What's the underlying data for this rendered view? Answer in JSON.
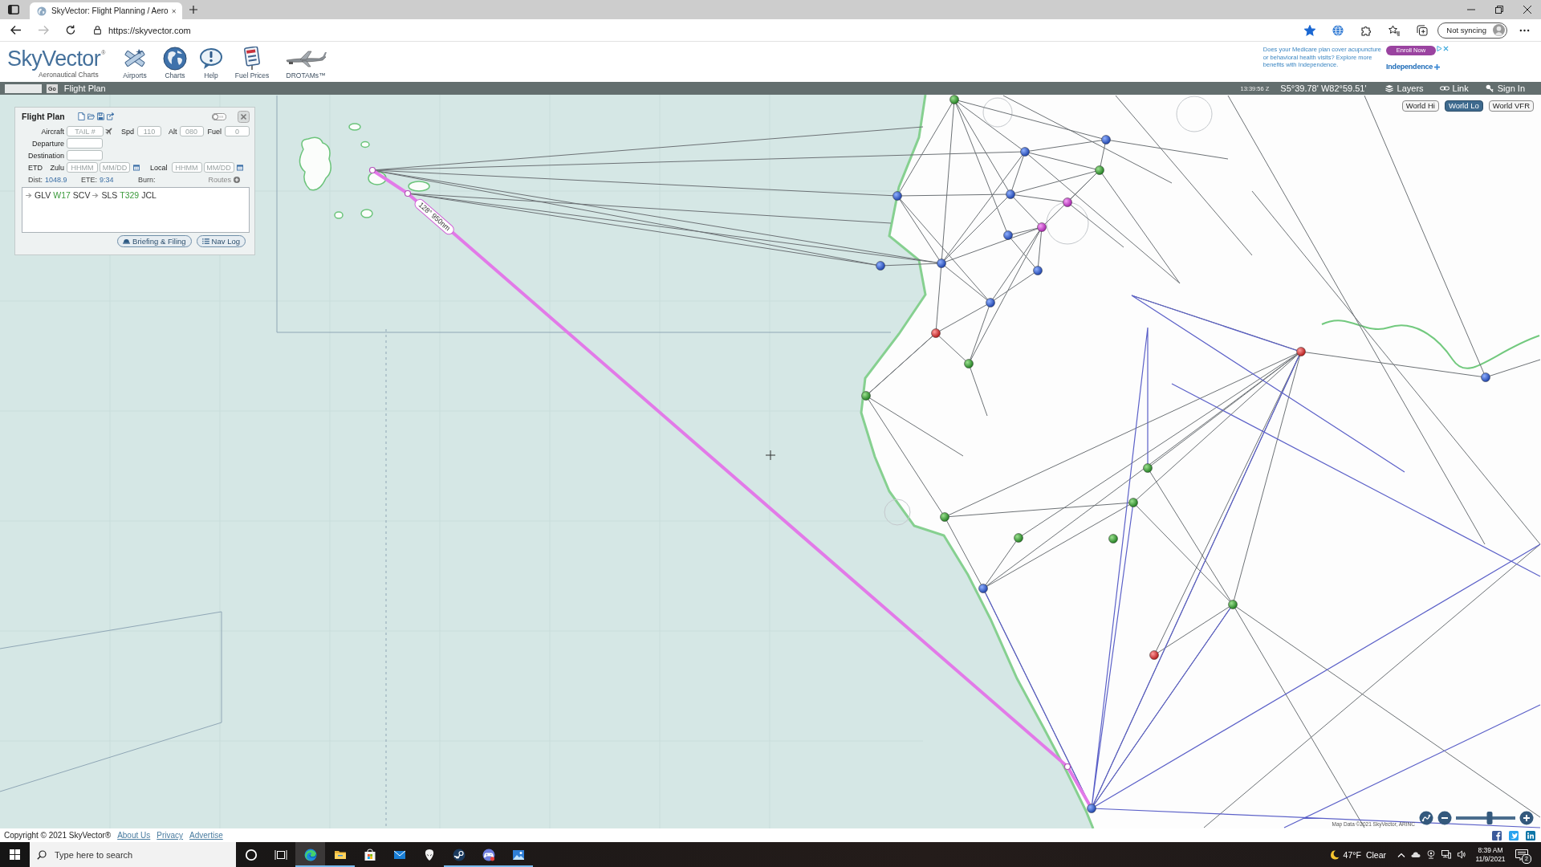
{
  "browser": {
    "tab_title": "SkyVector: Flight Planning / Aero",
    "url": "https://skyvector.com",
    "bookmarked": true,
    "profile_label": "Not syncing"
  },
  "site": {
    "logo": "SkyVector$^{®}$",
    "tagline": "Aeronautical Charts",
    "nav": [
      {
        "label": "Airports",
        "kind": "airports"
      },
      {
        "label": "Charts",
        "kind": "charts"
      },
      {
        "label": "Help",
        "kind": "help"
      },
      {
        "label": "Fuel Prices",
        "kind": "fuel"
      },
      {
        "label": "DROTAMs™",
        "kind": "drotams"
      }
    ]
  },
  "ad": {
    "text": "Does your Medicare plan cover acupuncture\nor behavioral health visits? Explore more\nbenefits with Independence.",
    "button": "Enroll Now",
    "brand": "Independence"
  },
  "toolbar": {
    "go_button": "Go",
    "flight_plan_button": "Flight Plan",
    "zulu_time": "13:39:56 Z",
    "coordinates": "S5°39.78' W82°59.51'",
    "links": [
      {
        "label": "Layers",
        "kind": "layers"
      },
      {
        "label": "Link",
        "kind": "link"
      },
      {
        "label": "Sign In",
        "kind": "sign_in"
      }
    ]
  },
  "chart_types": [
    {
      "label": "World Hi",
      "selected": false
    },
    {
      "label": "World Lo",
      "selected": true
    },
    {
      "label": "World VFR",
      "selected": false
    }
  ],
  "flight_plan": {
    "title": "Flight Plan",
    "switch_on": false,
    "aircraft": {
      "label": "Aircraft",
      "placeholder": "TAIL #"
    },
    "speed": {
      "label": "Spd",
      "placeholder": "110"
    },
    "altitude": {
      "label": "Alt",
      "placeholder": "080"
    },
    "fuel": {
      "label": "Fuel",
      "placeholder": "0"
    },
    "departure": {
      "label": "Departure"
    },
    "destination": {
      "label": "Destination"
    },
    "etd": {
      "label": "ETD",
      "zulu_label": "Zulu",
      "zulu_time_placeholder": "HHMM",
      "zulu_date_placeholder": "MM/DD",
      "local_label": "Local",
      "local_time_placeholder": "HHMM",
      "local_date_placeholder": "MM/DD"
    },
    "distance": {
      "label": "Dist:",
      "value": "1048.9"
    },
    "ete": {
      "label": "ETE:",
      "value": "9:34"
    },
    "burn": {
      "label": "Burn:"
    },
    "routes_link": "Routes",
    "route": [
      {
        "text": "GLV",
        "kind": "fix",
        "direct": true
      },
      {
        "text": "W17",
        "kind": "airway",
        "direct": false
      },
      {
        "text": "SCV",
        "kind": "fix",
        "direct": false
      },
      {
        "text": "SLS",
        "kind": "fix",
        "direct": true
      },
      {
        "text": "T329",
        "kind": "airway",
        "direct": false
      },
      {
        "text": "JCL",
        "kind": "fix",
        "direct": false
      }
    ],
    "buttons": [
      {
        "label": "Briefing & Filing",
        "kind": "briefing"
      },
      {
        "label": "Nav Log",
        "kind": "nav_log"
      }
    ]
  },
  "map": {
    "route_label": "128° 950nm",
    "attribution": "Map Data ©2021 SkyVector, ARINC",
    "zoom_slider": {
      "level": 0.57
    }
  },
  "footer": {
    "copyright": "Copyright © 2021 SkyVector®",
    "links": [
      "About Us",
      "Privacy",
      "Advertise"
    ]
  },
  "taskbar": {
    "search_placeholder": "Type here to search",
    "apps": [
      {
        "kind": "edge",
        "selected": true,
        "running": true
      },
      {
        "kind": "explorer",
        "selected": false,
        "running": true
      },
      {
        "kind": "store",
        "selected": false,
        "running": false
      },
      {
        "kind": "mail",
        "selected": false,
        "running": false
      },
      {
        "kind": "alienware",
        "selected": false,
        "running": false
      },
      {
        "kind": "steam",
        "selected": false,
        "running": true
      },
      {
        "kind": "discord",
        "selected": false,
        "running": true
      },
      {
        "kind": "photos",
        "selected": false,
        "running": true
      }
    ],
    "weather": {
      "temperature": "47°F",
      "condition": "Clear"
    },
    "time": "8:39 AM",
    "date": "11/9/2021",
    "notification_count": "2"
  }
}
